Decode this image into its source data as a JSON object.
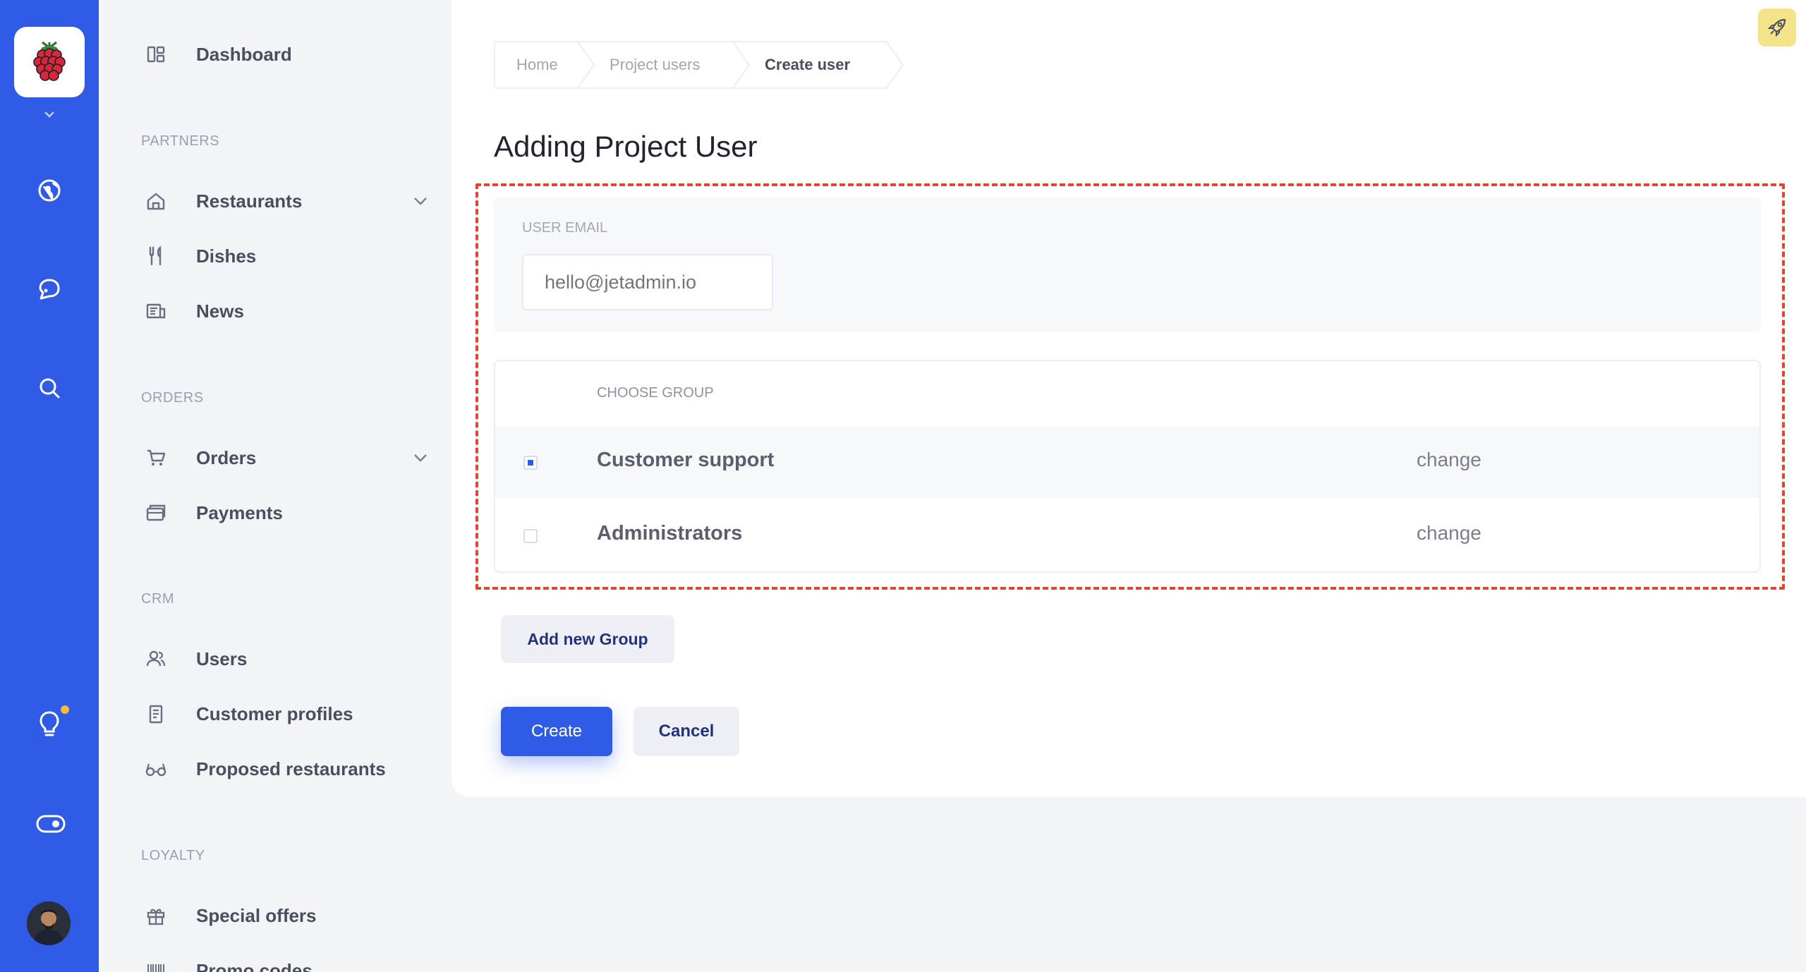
{
  "rail": {
    "icons": [
      "raspberry-logo",
      "chevron-down-icon",
      "globe-icon",
      "chat-icon",
      "search-icon",
      "lightbulb-icon",
      "toggle-icon",
      "avatar"
    ],
    "notification_color": "#f6b93b",
    "accent": "#2f5be6"
  },
  "sidebar": {
    "dashboard": "Dashboard",
    "sections": {
      "partners": "PARTNERS",
      "orders": "ORDERS",
      "crm": "CRM",
      "loyalty": "LOYALTY"
    },
    "items": {
      "restaurants": "Restaurants",
      "dishes": "Dishes",
      "news": "News",
      "orders": "Orders",
      "payments": "Payments",
      "users": "Users",
      "customer_profiles": "Customer profiles",
      "proposed_restaurants": "Proposed restaurants",
      "special_offers": "Special offers",
      "promo_codes": "Promo codes"
    }
  },
  "breadcrumb": {
    "home": "Home",
    "project_users": "Project users",
    "create_user": "Create user"
  },
  "page": {
    "title": "Adding Project User"
  },
  "form": {
    "email_label": "USER EMAIL",
    "email_placeholder": "hello@jetadmin.io",
    "group_heading": "CHOOSE GROUP",
    "groups": [
      {
        "name": "Customer support",
        "action": "change",
        "checked": true
      },
      {
        "name": "Administrators",
        "action": "change",
        "checked": false
      }
    ],
    "add_group": "Add new Group",
    "create": "Create",
    "cancel": "Cancel"
  },
  "colors": {
    "primary": "#2f5be6",
    "highlight_border": "#e8432e",
    "rocket_bg": "#f3e48a"
  }
}
